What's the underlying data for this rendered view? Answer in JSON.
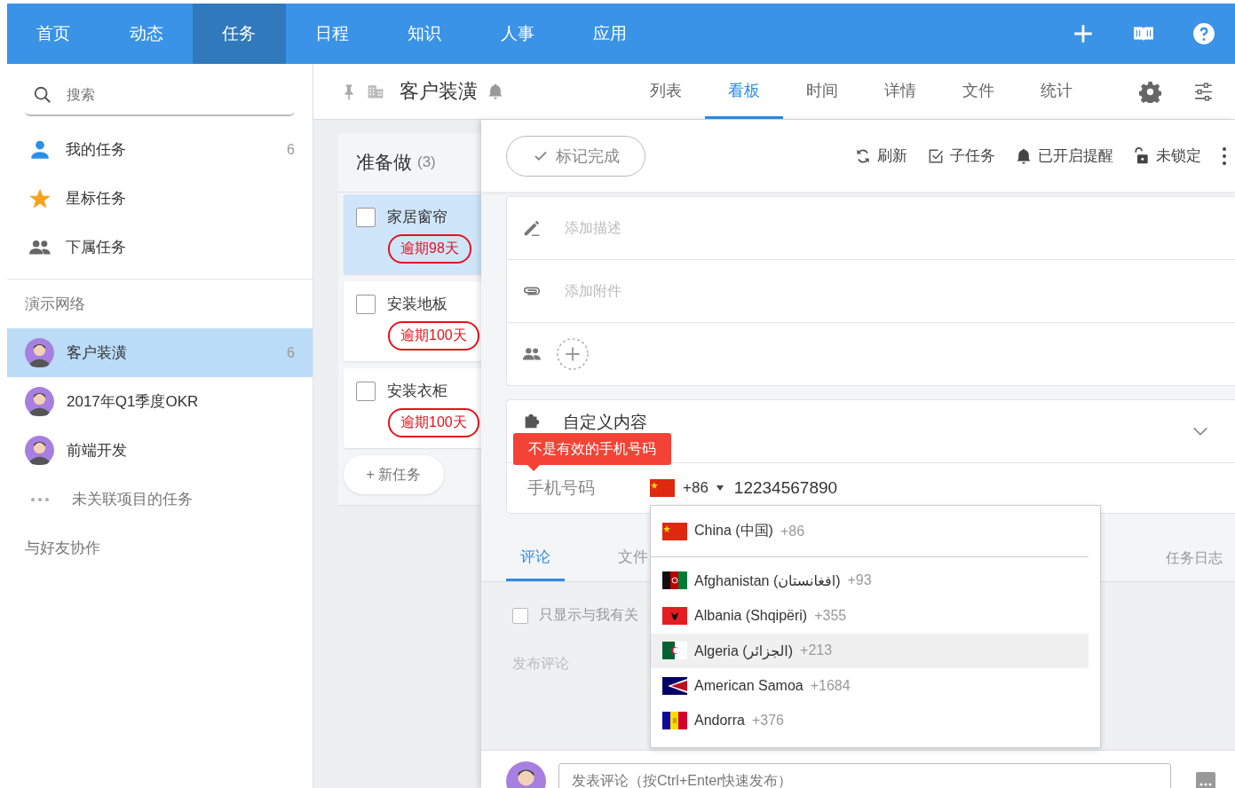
{
  "nav": {
    "tabs": [
      {
        "label": "首页",
        "selected": false
      },
      {
        "label": "动态",
        "selected": false
      },
      {
        "label": "任务",
        "selected": true
      },
      {
        "label": "日程",
        "selected": false
      },
      {
        "label": "知识",
        "selected": false
      },
      {
        "label": "人事",
        "selected": false
      },
      {
        "label": "应用",
        "selected": false
      }
    ]
  },
  "sidebar": {
    "search": {
      "placeholder": "搜索"
    },
    "filters": [
      {
        "kind": "person",
        "label": "我的任务",
        "count": "6"
      },
      {
        "kind": "star",
        "label": "星标任务"
      },
      {
        "kind": "group",
        "label": "下属任务"
      }
    ],
    "sections": [
      {
        "title": "演示网络",
        "projects": [
          {
            "kind": "avatar",
            "label": "客户装潢",
            "count": "6",
            "selected": true
          },
          {
            "kind": "avatar",
            "label": "2017年Q1季度OKR",
            "selected": false
          },
          {
            "kind": "avatar",
            "label": "前端开发",
            "selected": false
          },
          {
            "kind": "more",
            "label": "未关联项目的任务",
            "selected": false
          }
        ]
      },
      {
        "title": "与好友协作"
      }
    ]
  },
  "project": {
    "title": "客户装潢",
    "tabs": [
      {
        "label": "列表",
        "selected": false
      },
      {
        "label": "看板",
        "selected": true
      },
      {
        "label": "时间",
        "selected": false
      },
      {
        "label": "详情",
        "selected": false
      },
      {
        "label": "文件",
        "selected": false
      },
      {
        "label": "统计",
        "selected": false
      }
    ]
  },
  "board": {
    "title": "准备做",
    "count": "(3)",
    "cards": [
      {
        "title": "家居窗帘",
        "badge": "逾期98天",
        "selected": true,
        "checked": false
      },
      {
        "title": "安装地板",
        "badge": "逾期100天",
        "selected": false,
        "checked": false
      },
      {
        "title": "安装衣柜",
        "badge": "逾期100天",
        "selected": false,
        "checked": false
      }
    ],
    "add_button": "+ 新任务"
  },
  "task": {
    "complete_button": "标记完成",
    "actions": [
      {
        "kind": "refresh",
        "label": "刷新"
      },
      {
        "kind": "subtask",
        "label": "子任务"
      },
      {
        "kind": "bell",
        "label": "已开启提醒"
      },
      {
        "kind": "lock",
        "label": "未锁定"
      }
    ],
    "description": {
      "placeholder": "添加描述"
    },
    "attachment": {
      "placeholder": "添加附件"
    },
    "custom": {
      "title": "自定义内容"
    },
    "phone": {
      "label": "手机号码",
      "kind": "cn",
      "code": "+86",
      "value": "12234567890",
      "error": "不是有效的手机号码"
    },
    "dropdown": {
      "preferred": [
        {
          "kind": "cn",
          "name": "China (中国)",
          "code": "+86"
        }
      ],
      "countries": [
        {
          "kind": "af",
          "name": "Afghanistan (‫افغانستان‬‎)",
          "code": "+93",
          "selected": false
        },
        {
          "kind": "al",
          "name": "Albania (Shqipëri)",
          "code": "+355",
          "selected": false
        },
        {
          "kind": "dz",
          "name": "Algeria (‫الجزائر‬‎)",
          "code": "+213",
          "selected": true
        },
        {
          "kind": "as",
          "name": "American Samoa",
          "code": "+1684",
          "selected": false
        },
        {
          "kind": "ad",
          "name": "Andorra",
          "code": "+376",
          "selected": false
        }
      ]
    },
    "tabs": [
      {
        "label": "评论",
        "selected": true
      },
      {
        "label": "文件",
        "selected": false
      }
    ],
    "log_link": "任务日志",
    "filter": {
      "label": "只显示与我有关",
      "checked": false
    },
    "comment_prompt": "发布评论",
    "comment_box": {
      "placeholder": "发表评论（按Ctrl+Enter快速发布）"
    }
  }
}
